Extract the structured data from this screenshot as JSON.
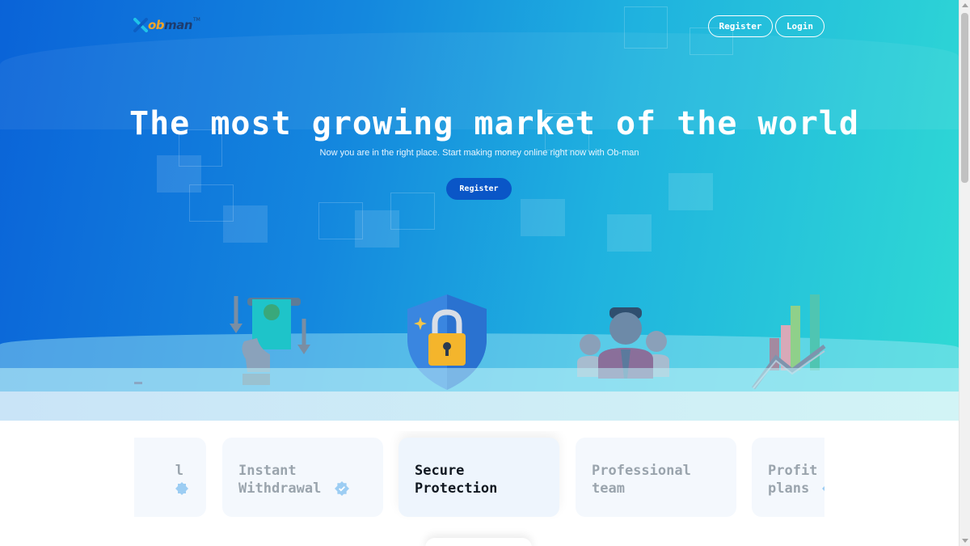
{
  "header": {
    "logo": {
      "text_part1": "ob",
      "text_part2": "man",
      "trademark": "TM"
    },
    "register_label": "Register",
    "login_label": "Login"
  },
  "hero": {
    "title": "The most growing market of the world",
    "subtitle": "Now you are in the right place. Start making money online right now with Ob-man",
    "cta_label": "Register",
    "illustrations": [
      "money-withdrawal-icon",
      "security-shield-lock-icon",
      "team-people-icon",
      "growth-chart-icon"
    ]
  },
  "features": {
    "cards": [
      {
        "label_partial": "l",
        "state": "partial"
      },
      {
        "line1": "Instant",
        "line2": "Withdrawal",
        "state": "inactive"
      },
      {
        "line1": "Secure",
        "line2": "Protection",
        "state": "active"
      },
      {
        "line1": "Professional",
        "line2": "team",
        "state": "inactive"
      },
      {
        "line1": "Profit",
        "line2": "plans",
        "state": "inactive"
      }
    ]
  },
  "colors": {
    "hero_gradient_start": "#0a63d8",
    "hero_gradient_end": "#2fdad4",
    "cta_background": "#0a56c7",
    "logo_orange": "#f7a526",
    "logo_navy": "#1d3c6e",
    "active_text": "#111821",
    "inactive_text": "#9aa4ad",
    "badge_blue": "#5fb2f0"
  }
}
